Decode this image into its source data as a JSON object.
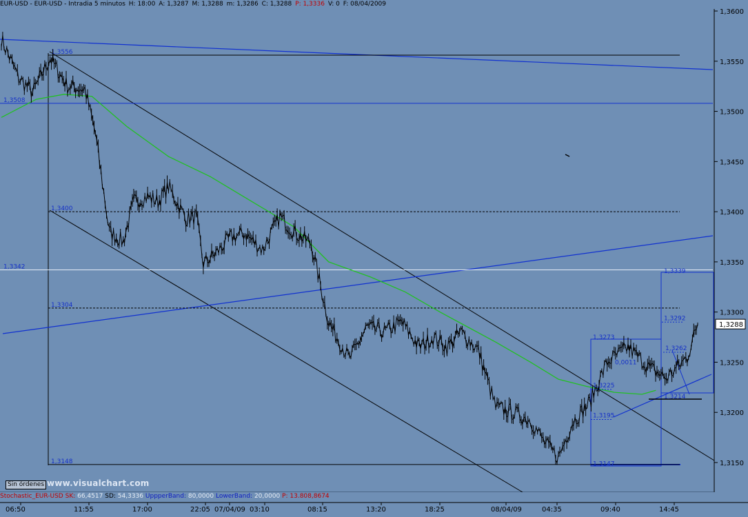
{
  "header": {
    "symbol": "EUR-USD - EUR-USD - Intradia 5 minutos",
    "h": "H: 18:00",
    "a": "A: 1,3287",
    "m": "M: 1,3288",
    "low": "m: 1,3286",
    "c": "C: 1,3288",
    "p": "P: 1,3336",
    "v": "V: 0",
    "f": "F: 08/04/2009"
  },
  "footer": {
    "orders_label": "Sin órdenes",
    "watermark": "www.visualchart.com"
  },
  "indicator": {
    "name": "Stochastic_EUR-USD",
    "sk_label": "SK:",
    "sk_value": "66,4517",
    "sd_label": "SD:",
    "sd_value": "54,3336",
    "upper_label": "UppperBand:",
    "upper_value": "80,0000",
    "lower_label": "LowerBand:",
    "lower_value": "20,0000",
    "p_label": "P:",
    "p_value": "13.808,8674"
  },
  "colors": {
    "background": "#6F8FB5",
    "price": "#000000",
    "moving_average": "#22C022",
    "trendline_blue": "#1030D0",
    "channel": "#000000",
    "level_label": "#1530C8",
    "highlight_line": "#E6EEF7",
    "current_price_box": "#FFFFFF"
  },
  "chart_data": {
    "type": "line",
    "title": "EUR-USD - EUR-USD - Intradia 5 minutos",
    "ylim": [
      1.3135,
      1.3608
    ],
    "y_ticks": [
      "1,3600",
      "1,3550",
      "1,3500",
      "1,3450",
      "1,3400",
      "1,3350",
      "1,3300",
      "1,3250",
      "1,3200",
      "1,3150"
    ],
    "x_ticks": [
      "06:50",
      "11:55",
      "17:00",
      "22:05",
      "07/04/09",
      "03:10",
      "08:15",
      "13:20",
      "18:25",
      "08/04/09",
      "04:35",
      "09:40",
      "14:45"
    ],
    "current_price": "1,3288",
    "series": [
      {
        "name": "EUR-USD",
        "x": [
          0,
          2.5,
          4.5,
          7,
          9.5,
          12,
          13.5,
          15.5,
          17.5,
          19,
          21,
          22.5,
          24,
          26.5,
          28,
          29,
          31,
          33,
          35,
          37.5,
          40,
          42,
          44.5,
          47,
          50,
          52.5,
          55,
          57.5,
          60,
          62,
          64,
          66,
          68.5,
          71,
          73.5,
          76,
          78,
          80,
          82,
          84.5,
          87,
          90,
          93,
          95.5,
          98.5,
          100
        ],
        "values": [
          1.3572,
          1.3533,
          1.3519,
          1.3553,
          1.3525,
          1.3522,
          1.3478,
          1.338,
          1.337,
          1.341,
          1.3415,
          1.341,
          1.3425,
          1.3393,
          1.3395,
          1.3348,
          1.336,
          1.3375,
          1.3378,
          1.3362,
          1.3395,
          1.338,
          1.3368,
          1.329,
          1.3253,
          1.3285,
          1.328,
          1.329,
          1.3265,
          1.3275,
          1.3265,
          1.328,
          1.3262,
          1.3205,
          1.32,
          1.3192,
          1.317,
          1.3155,
          1.319,
          1.321,
          1.325,
          1.3265,
          1.3245,
          1.3234,
          1.3255,
          1.3288
        ]
      },
      {
        "name": "Moving average",
        "x": [
          0,
          5,
          9,
          13,
          18,
          24,
          30,
          36,
          42,
          47,
          53,
          58,
          63,
          67,
          71,
          76,
          80,
          84,
          88,
          92,
          94
        ],
        "values": [
          1.3494,
          1.3512,
          1.3517,
          1.3515,
          1.3485,
          1.3455,
          1.3435,
          1.341,
          1.3385,
          1.335,
          1.3335,
          1.332,
          1.33,
          1.3285,
          1.327,
          1.325,
          1.3233,
          1.3226,
          1.322,
          1.3218,
          1.3222
        ]
      }
    ],
    "levels": [
      {
        "label": "1,3556",
        "value": 1.3556,
        "style": "solid"
      },
      {
        "label": "1,3508",
        "value": 1.3508,
        "style": "solid-blue"
      },
      {
        "label": "1,3400",
        "value": 1.34,
        "style": "dotted"
      },
      {
        "label": "1,3342",
        "value": 1.3342,
        "style": "solid-light"
      },
      {
        "label": "1,3304",
        "value": 1.3304,
        "style": "dotted"
      },
      {
        "label": "1,3148",
        "value": 1.3148,
        "style": "solid"
      }
    ],
    "box_labels": [
      {
        "label": "1,3339",
        "value": 1.3339
      },
      {
        "label": "1,3292",
        "value": 1.3292
      },
      {
        "label": "1,3273",
        "value": 1.3273
      },
      {
        "label": "1,3262",
        "value": 1.3262
      },
      {
        "label": "1,3225",
        "value": 1.3225
      },
      {
        "label": "1,3214",
        "value": 1.3214
      },
      {
        "label": "1,3195",
        "value": 1.3195
      },
      {
        "label": "1,3147",
        "value": 1.3147
      }
    ],
    "annotation": "0,0011"
  }
}
